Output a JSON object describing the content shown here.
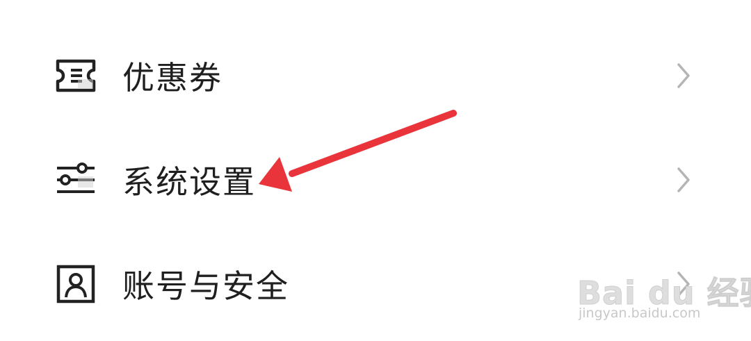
{
  "menu": {
    "items": [
      {
        "label": "优惠券",
        "icon": "coupon-icon"
      },
      {
        "label": "系统设置",
        "icon": "settings-sliders-icon"
      },
      {
        "label": "账号与安全",
        "icon": "account-icon"
      }
    ],
    "chevron_icon": "chevron-right-icon"
  },
  "annotation": {
    "arrow_color": "#e8343a",
    "target": "系统设置"
  },
  "watermark": {
    "brand": "Bai du 经验",
    "url": "jingyan.baidu.com"
  },
  "colors": {
    "text": "#1f1f1f",
    "icon": "#222222",
    "chevron": "#b5b5b5",
    "background": "#ffffff"
  }
}
